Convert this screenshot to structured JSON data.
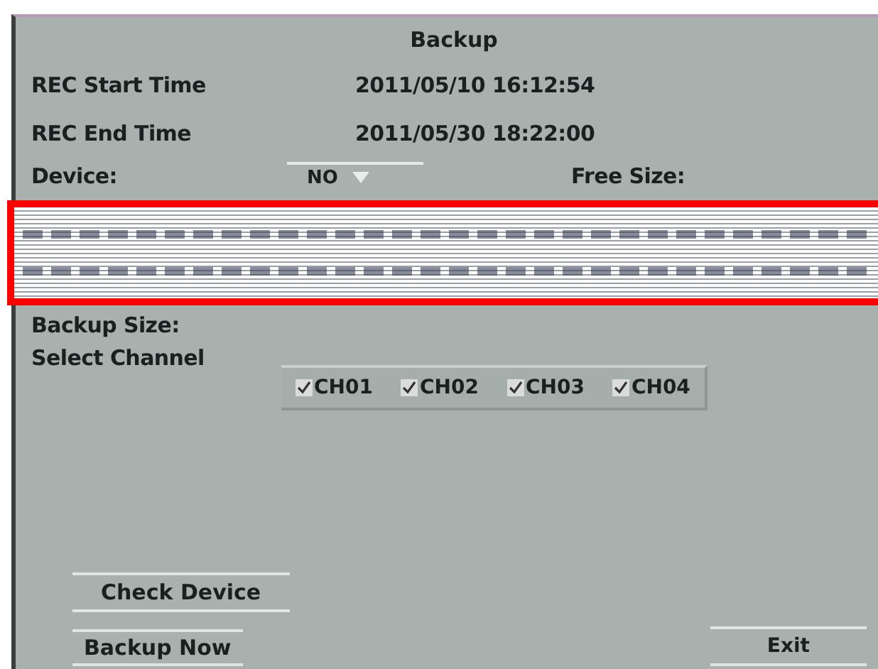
{
  "title": "Backup",
  "fields": [
    {
      "label": "REC Start Time",
      "value": "2011/05/10 16:12:54"
    },
    {
      "label": "REC End Time",
      "value": "2011/05/30 18:22:00"
    }
  ],
  "device": {
    "label": "Device:",
    "value": "NO"
  },
  "free_size": {
    "label": "Free Size:"
  },
  "backup_size": {
    "label": "Backup Size:"
  },
  "select_channel": {
    "label": "Select Channel",
    "channels": [
      {
        "label": "CH01",
        "checked": true
      },
      {
        "label": "CH02",
        "checked": true
      },
      {
        "label": "CH03",
        "checked": true
      },
      {
        "label": "CH04",
        "checked": true
      }
    ]
  },
  "buttons": {
    "check_device": "Check Device",
    "backup_now": "Backup Now",
    "exit": "Exit"
  }
}
